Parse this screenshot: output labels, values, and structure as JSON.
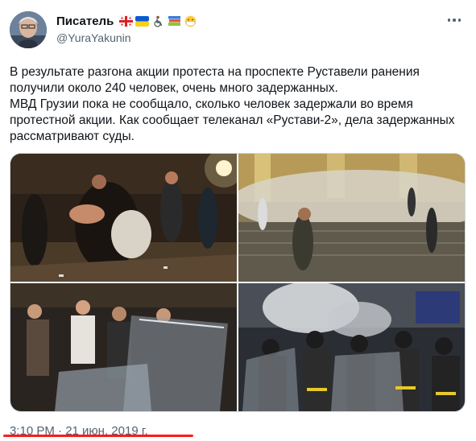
{
  "author": {
    "name": "Писатель",
    "handle": "@YuraYakunin",
    "badge_icons": [
      "georgia-flag-icon",
      "ukraine-flag-icon",
      "wheelchair-icon",
      "books-icon",
      "face-mask-icon"
    ]
  },
  "tweet": {
    "paragraph1": "В результате разгона акции протеста на проспекте Руставели ранения получили около 240 человек, очень много задержанных.",
    "paragraph2": " МВД Грузии пока не сообщало, сколько человек задержали во время протестной акции. Как сообщает телеканал «Рустави-2», дела задержанных рассматривают суды."
  },
  "timestamp": "3:10 PM · 21 июн. 2019 г.",
  "colors": {
    "text": "#0f1419",
    "secondary": "#536471",
    "highlight": "#ff1a1a"
  }
}
